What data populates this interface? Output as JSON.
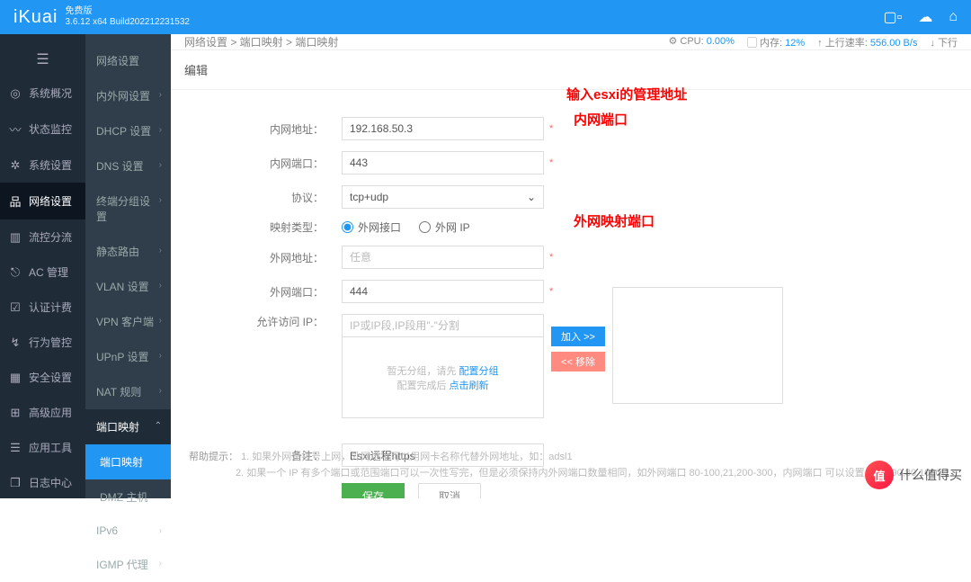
{
  "header": {
    "logo": "iKuai",
    "ver_caption": "免费版",
    "ver_build": "3.6.12 x64 Build202212231532"
  },
  "nav1": {
    "items": [
      {
        "icon": "◎",
        "label": "系统概况"
      },
      {
        "icon": "〰",
        "label": "状态监控"
      },
      {
        "icon": "✲",
        "label": "系统设置"
      },
      {
        "icon": "品",
        "label": "网络设置",
        "active": true
      },
      {
        "icon": "▥",
        "label": "流控分流"
      },
      {
        "icon": "⎋",
        "label": "AC 管理"
      },
      {
        "icon": "☑",
        "label": "认证计费"
      },
      {
        "icon": "↯",
        "label": "行为管控"
      },
      {
        "icon": "▦",
        "label": "安全设置"
      },
      {
        "icon": "⊞",
        "label": "高级应用"
      },
      {
        "icon": "☰",
        "label": "应用工具"
      },
      {
        "icon": "❐",
        "label": "日志中心"
      }
    ]
  },
  "nav2": {
    "items": [
      "网络设置",
      "内外网设置",
      "DHCP 设置",
      "DNS 设置",
      "终端分组设置",
      "静态路由",
      "VLAN 设置",
      "VPN 客户端",
      "UPnP 设置",
      "NAT 规则"
    ],
    "active_parent": "端口映射",
    "subs": [
      "端口映射",
      "DMZ 主机"
    ],
    "sub_active_index": 0,
    "tail": [
      "IPv6",
      "IGMP 代理"
    ]
  },
  "crumb": [
    "网络设置",
    "端口映射",
    "端口映射"
  ],
  "status": {
    "cpu_label": "CPU:",
    "cpu": "0.00%",
    "mem_label": "内存:",
    "mem": "12%",
    "up_label": "上行速率:",
    "up": "556.00 B/s",
    "down_label": "下行"
  },
  "edit_title": "编辑",
  "form": {
    "intranet_addr": {
      "label": "内网地址：",
      "value": "192.168.50.3"
    },
    "intranet_port": {
      "label": "内网端口：",
      "value": "443"
    },
    "protocol": {
      "label": "协议：",
      "value": "tcp+udp"
    },
    "map_type": {
      "label": "映射类型：",
      "opt1": "外网接口",
      "opt2": "外网 IP"
    },
    "extranet_addr": {
      "label": "外网地址：",
      "placeholder": "任意"
    },
    "extranet_port": {
      "label": "外网端口：",
      "value": "444"
    },
    "allow_ip": {
      "label": "允许访问 IP：",
      "placeholder": "IP或IP段,IP段用\"-\"分割"
    },
    "box_empty1": "暂无分组，请先",
    "box_link1": "配置分组",
    "box_empty2": "配置完成后",
    "box_link2": "点击刷新",
    "btn_add": "加入 >>",
    "btn_rem": "<< 移除",
    "remark": {
      "label": "备注：",
      "value": "Esxi远程https"
    },
    "save": "保存",
    "cancel": "取消"
  },
  "annotations": {
    "a1": "输入esxi的管理地址",
    "a2": "内网端口",
    "a3": "外网映射端口"
  },
  "help": {
    "title": "帮助提示：",
    "l1": "1. 如果外网是拨号上网，外网地址可以用网卡名称代替外网地址，如：adsl1",
    "l2": "2. 如果一个 IP 有多个端口或范围端口可以一次性写完，但是必须保持内外网端口数量相同，如外网端口 80-100,21,200-300，内网端口 可以设置为 70-90,80,1000-1"
  },
  "badge": {
    "text": "什么值得买",
    "mark": "值"
  }
}
